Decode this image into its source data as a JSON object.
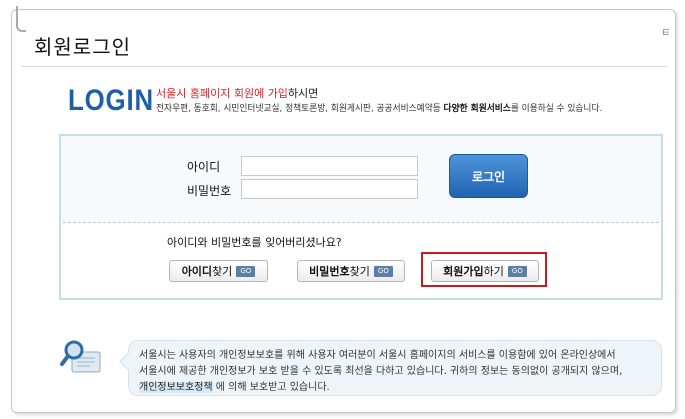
{
  "page": {
    "title": "회원로그인",
    "edge_glyph": "ㅌ"
  },
  "intro": {
    "logo": "LOGIN",
    "headline_red": "서울시 홈페이지 회원에 가입",
    "headline_rest": "하시면",
    "services_pre": "전자우편, 동호회, 시민인터넷교실, 정책토론방, 회원게시판, 공공서비스예약등 ",
    "services_bold1": "다양한 회원서비스",
    "services_post": "를 이용하실 수 있습니다."
  },
  "form": {
    "id_label": "아이디",
    "password_label": "비밀번호",
    "id_value": "",
    "password_value": "",
    "login_button": "로그인"
  },
  "recovery": {
    "question": "아이디와 비밀번호를 잊어버리셨나요?",
    "find_id_bold": "아이디",
    "find_id_rest": " 찾기",
    "find_pw_bold": "비밀번호",
    "find_pw_rest": "찾기",
    "signup_bold": "회원가입",
    "signup_rest": "하기",
    "go_label": "GO"
  },
  "notice": {
    "line1": "서울시는 사용자의 개인정보보호를 위해 사용자 여러분이 서울시 홈페이지의 서비스를 이용함에 있어 온라인상에서",
    "line2": "서울시에 제공한 개인정보가 보호 받을 수 있도록 최선을 다하고 있습니다. 귀하의 정보는 동의없이 공개되지 않으며,",
    "policy_link": "개인정보보호정책",
    "line3_rest": "에 의해 보호받고 있습니다."
  },
  "colors": {
    "accent": "#1f64b4",
    "highlight": "#c31c1c",
    "headline": "#d7262b"
  }
}
